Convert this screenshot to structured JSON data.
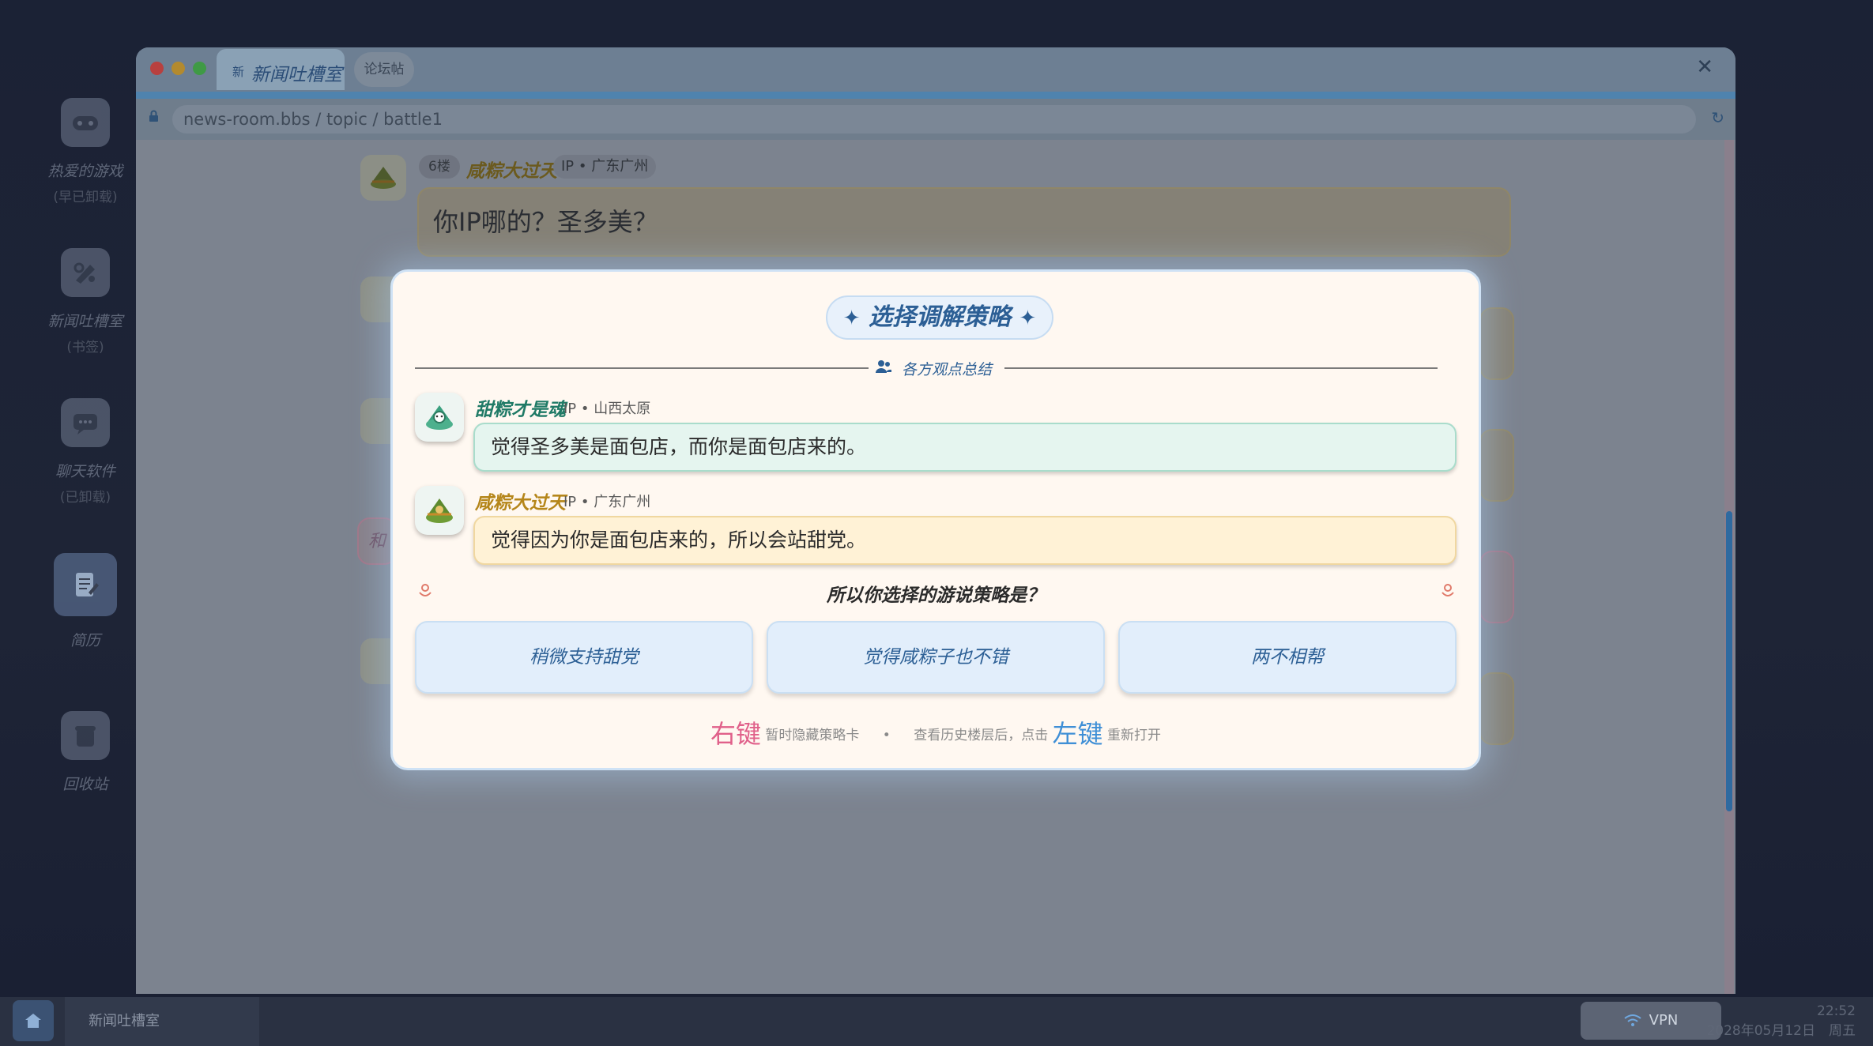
{
  "desktop": {
    "icons": [
      {
        "label": "热爱的游戏",
        "sub": "(早已卸载)",
        "icon": "gamepad-icon"
      },
      {
        "label": "新闻吐槽室",
        "sub": "(书签)",
        "icon": "newsroom-icon"
      },
      {
        "label": "聊天软件",
        "sub": "(已卸载)",
        "icon": "chat-icon"
      },
      {
        "label": "简历",
        "sub": "",
        "icon": "resume-icon"
      },
      {
        "label": "回收站",
        "sub": "",
        "icon": "trash-icon"
      }
    ]
  },
  "window": {
    "tab_icon": "新",
    "tab_active": "新闻吐槽室",
    "tab_secondary": "论坛帖",
    "close": "✕",
    "address": "news-room.bbs / topic / battle1",
    "reload": "↻"
  },
  "background_post": {
    "floor": "6楼",
    "author": "咸粽大过天",
    "ip": "IP • 广东广州",
    "text": "你IP哪的？圣多美？",
    "partial_label": "和"
  },
  "modal": {
    "title": "选择调解策略",
    "star": "✦",
    "summary_label": "各方观点总结",
    "views": [
      {
        "name": "甜粽才是魂",
        "ip": "IP • 山西太原",
        "text": "觉得圣多美是面包店，而你是面包店来的。",
        "color": "#1f7a66"
      },
      {
        "name": "咸粽大过天",
        "ip": "IP • 广东广州",
        "text": "觉得因为你是面包店来的，所以会站甜党。",
        "color": "#b5861a"
      }
    ],
    "question": "所以你选择的游说策略是？",
    "choices": [
      "稍微支持甜党",
      "觉得咸粽子也不错",
      "两不相帮"
    ],
    "hint": {
      "right_key": "右键",
      "right_text": "暂时隐藏策略卡",
      "dot": "•",
      "left_prefix": "查看历史楼层后，点击",
      "left_key": "左键",
      "left_text": "重新打开"
    }
  },
  "taskbar": {
    "app": "新闻吐槽室",
    "vpn": "VPN",
    "time": "22:52",
    "date": "2028年05月12日　周五"
  }
}
